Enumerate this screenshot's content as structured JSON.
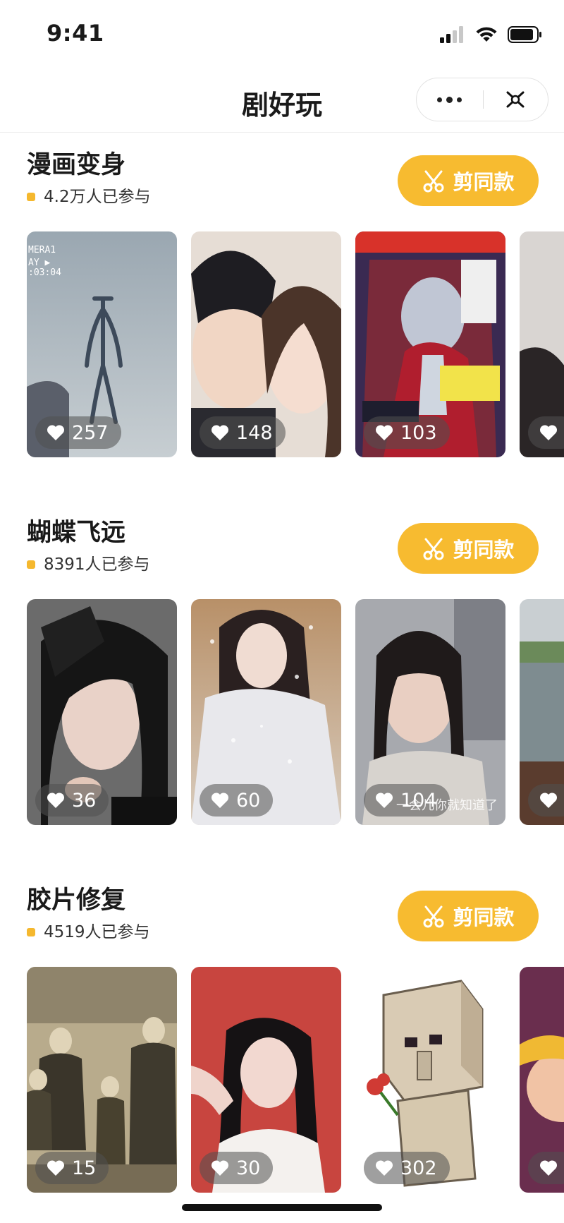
{
  "status_bar": {
    "time": "9:41"
  },
  "nav": {
    "title": "剧好玩"
  },
  "cut_button_label": "剪同款",
  "sections": [
    {
      "title": "漫画变身",
      "participants": "4.2万人已参与",
      "cards": [
        {
          "likes": "257",
          "image": "siren-head-creature-photo"
        },
        {
          "likes": "148",
          "image": "couple-selfie"
        },
        {
          "likes": "103",
          "image": "ultraman-magazine-cover"
        },
        {
          "likes": "",
          "image": "partial-card"
        }
      ]
    },
    {
      "title": "蝴蝶飞远",
      "participants": "8391人已参与",
      "cards": [
        {
          "likes": "36",
          "image": "woman-with-veil-hat"
        },
        {
          "likes": "60",
          "image": "woman-with-butterflies"
        },
        {
          "likes": "104",
          "image": "drama-scene-woman",
          "caption": "一会儿你就知道了"
        },
        {
          "likes": "",
          "image": "lake-scene-partial"
        }
      ]
    },
    {
      "title": "胶片修复",
      "participants": "4519人已参与",
      "cards": [
        {
          "likes": "15",
          "image": "old-family-photo"
        },
        {
          "likes": "30",
          "image": "woman-red-background"
        },
        {
          "likes": "302",
          "image": "minecraft-golem-with-flower"
        },
        {
          "likes": "",
          "image": "cartoon-character-partial"
        }
      ]
    }
  ],
  "colors": {
    "accent": "#f7bb30",
    "bullet": "#f5b82e"
  }
}
